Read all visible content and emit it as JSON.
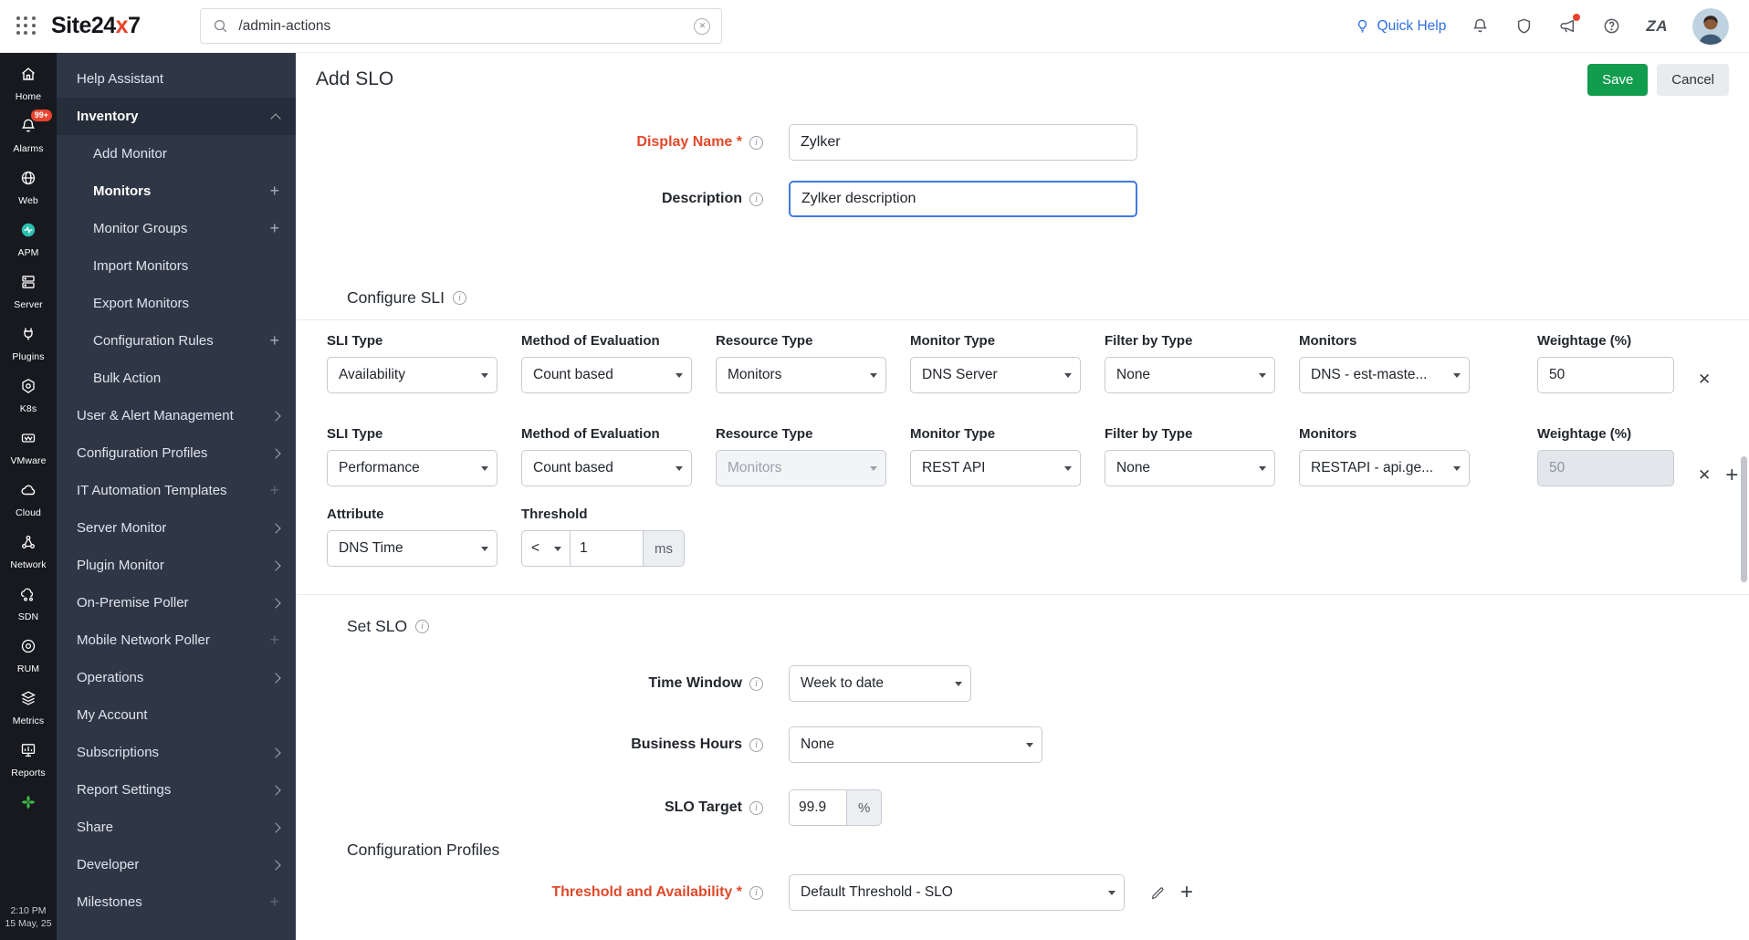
{
  "topbar": {
    "logo": {
      "site": "Site",
      "two4": "24",
      "x": "x",
      "seven": "7"
    },
    "search": {
      "value": "/admin-actions"
    },
    "quick_help": "Quick Help",
    "zia": "ZA",
    "icons": [
      "apps-grid-icon",
      "search-icon",
      "clear-icon",
      "bulb-icon",
      "bell-icon",
      "shield-icon",
      "megaphone-icon",
      "help-icon",
      "zia-logo-icon",
      "avatar"
    ]
  },
  "rail": {
    "items": [
      {
        "label": "Home",
        "icon": "home-icon"
      },
      {
        "label": "Alarms",
        "icon": "alarm-bell-icon",
        "badge": "99+"
      },
      {
        "label": "Web",
        "icon": "globe-icon"
      },
      {
        "label": "APM",
        "icon": "apm-icon"
      },
      {
        "label": "Server",
        "icon": "server-icon"
      },
      {
        "label": "Plugins",
        "icon": "plugins-icon"
      },
      {
        "label": "K8s",
        "icon": "kubernetes-icon"
      },
      {
        "label": "VMware",
        "icon": "vmware-icon"
      },
      {
        "label": "Cloud",
        "icon": "cloud-icon"
      },
      {
        "label": "Network",
        "icon": "network-icon"
      },
      {
        "label": "SDN",
        "icon": "sdn-icon"
      },
      {
        "label": "RUM",
        "icon": "rum-icon"
      },
      {
        "label": "Metrics",
        "icon": "metrics-icon"
      },
      {
        "label": "Reports",
        "icon": "reports-icon"
      }
    ],
    "extra_icon": "status-green-icon",
    "time": "2:10 PM",
    "date": "15 May, 25"
  },
  "sidebar": {
    "items": [
      {
        "label": "Help Assistant"
      },
      {
        "label": "Inventory",
        "state": "expanded-selected"
      },
      {
        "label": "Add Monitor"
      },
      {
        "label": "Monitors",
        "suffix": "plus"
      },
      {
        "label": "Monitor Groups",
        "suffix": "plus"
      },
      {
        "label": "Import Monitors"
      },
      {
        "label": "Export Monitors"
      },
      {
        "label": "Configuration Rules",
        "suffix": "plus"
      },
      {
        "label": "Bulk Action"
      },
      {
        "label": "User & Alert Management",
        "suffix": "chevron"
      },
      {
        "label": "Configuration Profiles",
        "suffix": "chevron"
      },
      {
        "label": "IT Automation Templates",
        "suffix": "plus-dim"
      },
      {
        "label": "Server Monitor",
        "suffix": "chevron"
      },
      {
        "label": "Plugin Monitor",
        "suffix": "chevron"
      },
      {
        "label": "On-Premise Poller",
        "suffix": "chevron"
      },
      {
        "label": "Mobile Network Poller",
        "suffix": "plus-dim"
      },
      {
        "label": "Operations",
        "suffix": "chevron"
      },
      {
        "label": "My Account"
      },
      {
        "label": "Subscriptions",
        "suffix": "chevron"
      },
      {
        "label": "Report Settings",
        "suffix": "chevron"
      },
      {
        "label": "Share",
        "suffix": "chevron"
      },
      {
        "label": "Developer",
        "suffix": "chevron"
      },
      {
        "label": "Milestones",
        "suffix": "plus-dim"
      }
    ]
  },
  "main": {
    "title": "Add SLO",
    "save": "Save",
    "cancel": "Cancel",
    "display_name": {
      "label": "Display Name *",
      "value": "Zylker"
    },
    "description": {
      "label": "Description",
      "value": "Zylker description"
    },
    "configure_sli": {
      "heading": "Configure SLI",
      "headers": {
        "sli_type": "SLI Type",
        "method": "Method of Evaluation",
        "resource_type": "Resource Type",
        "monitor_type": "Monitor Type",
        "filter_by_type": "Filter by Type",
        "monitors": "Monitors",
        "weightage": "Weightage (%)",
        "attribute": "Attribute",
        "threshold": "Threshold"
      },
      "row1": {
        "sli_type": "Availability",
        "method": "Count based",
        "resource_type": "Monitors",
        "monitor_type": "DNS Server",
        "filter_by_type": "None",
        "monitors": "DNS - est-maste...",
        "weightage": "50"
      },
      "row2": {
        "sli_type": "Performance",
        "method": "Count based",
        "resource_type": "Monitors",
        "monitor_type": "REST API",
        "filter_by_type": "None",
        "monitors": "RESTAPI - api.ge...",
        "weightage": "50",
        "attribute": "DNS Time",
        "threshold_operator": "<",
        "threshold_value": "1",
        "threshold_unit": "ms"
      }
    },
    "set_slo": {
      "heading": "Set SLO",
      "time_window": {
        "label": "Time Window",
        "value": "Week to date"
      },
      "business_hours": {
        "label": "Business Hours",
        "value": "None"
      },
      "slo_target": {
        "label": "SLO Target",
        "value": "99.9",
        "unit": "%"
      }
    },
    "config_profiles": {
      "heading": "Configuration Profiles",
      "threshold_availability": {
        "label": "Threshold and Availability *",
        "value": "Default Threshold - SLO"
      }
    }
  }
}
